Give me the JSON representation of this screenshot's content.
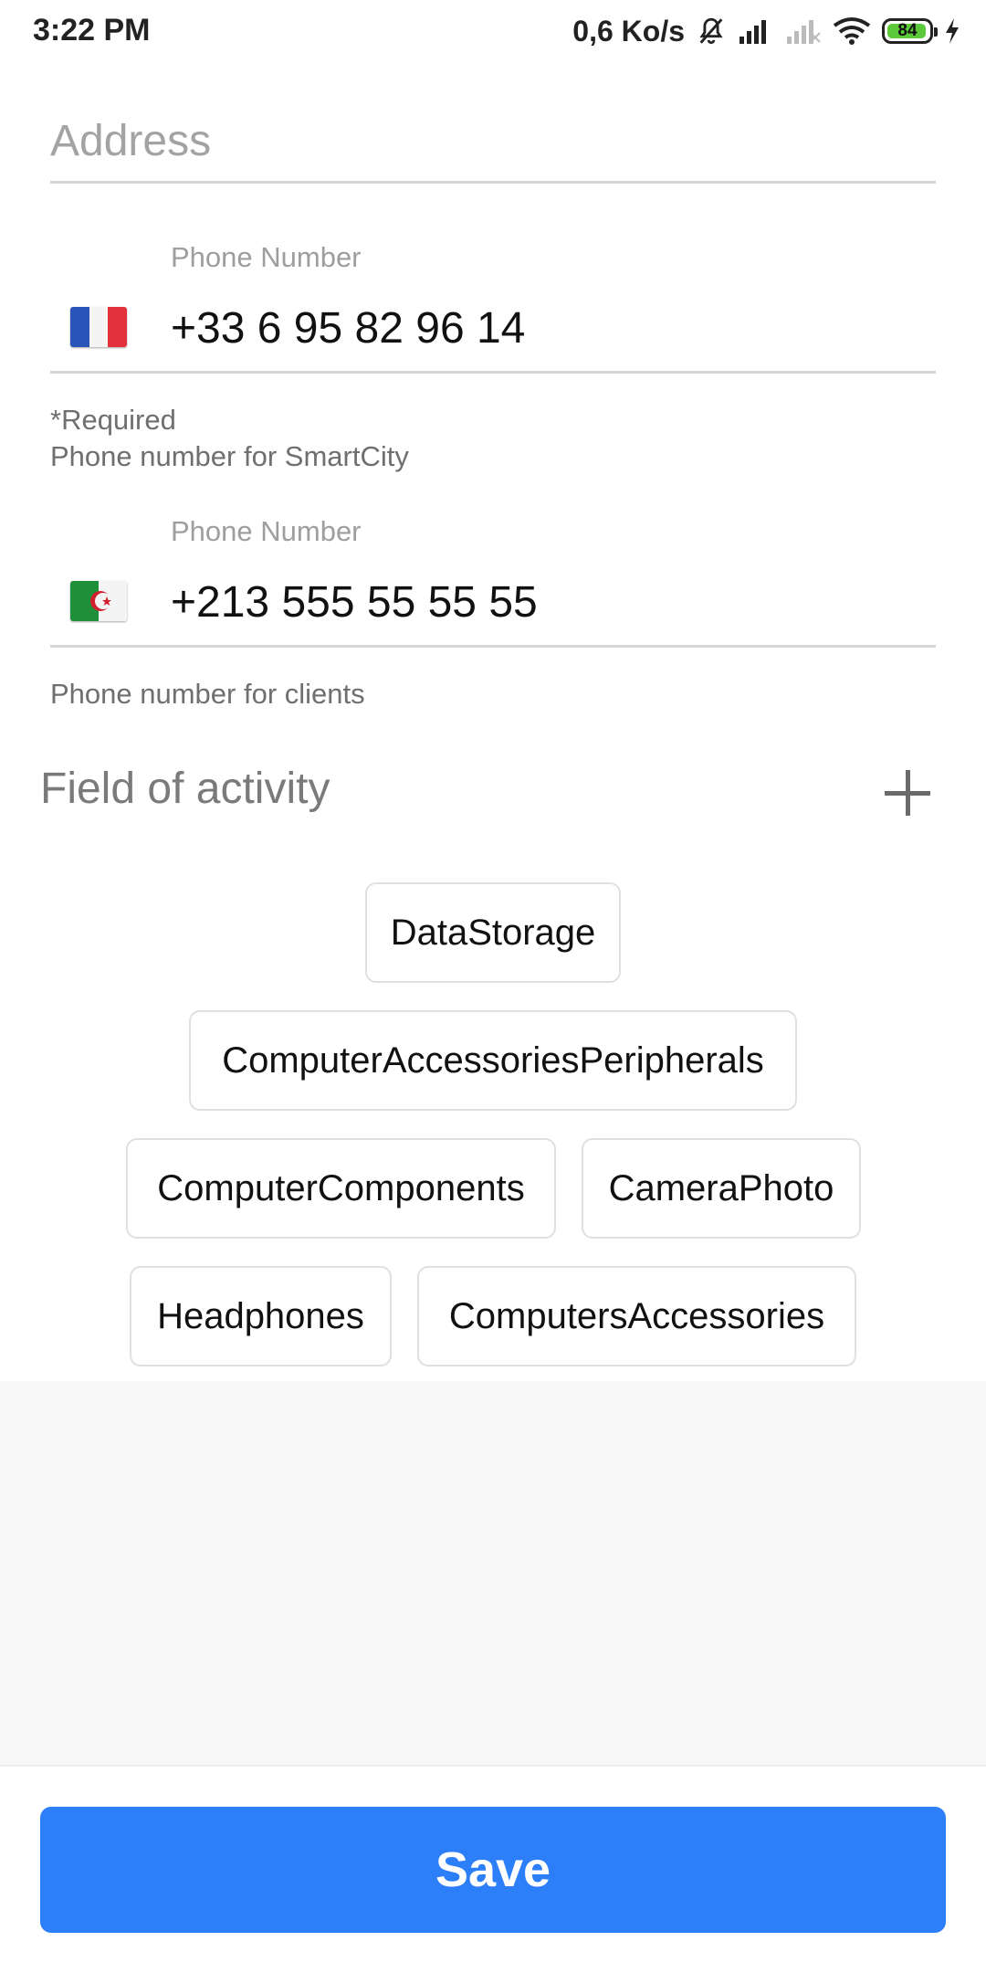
{
  "status_bar": {
    "time": "3:22 PM",
    "net_speed": "0,6 Ko/s",
    "battery_level": "84",
    "icons": [
      "mute-bell-icon",
      "signal-icon",
      "signal-empty-icon",
      "wifi-icon",
      "battery-icon",
      "charging-bolt-icon"
    ]
  },
  "address": {
    "placeholder": "Address"
  },
  "phones": [
    {
      "label": "Phone Number",
      "country": "France",
      "value": "+33 6 95 82 96 14",
      "required_note": "*Required",
      "helper": "Phone number for SmartCity"
    },
    {
      "label": "Phone Number",
      "country": "Algeria",
      "value": "+213 555 55 55 55",
      "helper": "Phone number for clients"
    }
  ],
  "activity": {
    "title": "Field of activity",
    "chips": [
      "DataStorage",
      "ComputerAccessoriesPeripherals",
      "ComputerComponents",
      "CameraPhoto",
      "Headphones",
      "ComputersAccessories"
    ]
  },
  "actions": {
    "save_label": "Save"
  },
  "colors": {
    "primary": "#2d7ff9",
    "divider": "#d6d6d6",
    "muted_text": "#9e9e9e"
  }
}
